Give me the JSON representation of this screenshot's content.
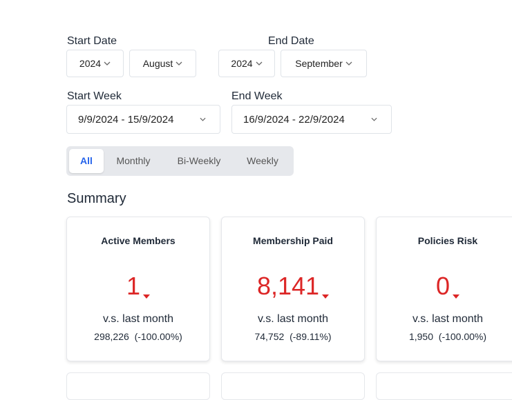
{
  "filters": {
    "start_date_label": "Start Date",
    "end_date_label": "End Date",
    "start_year": "2024",
    "start_month": "August",
    "end_year": "2024",
    "end_month": "September",
    "start_week_label": "Start Week",
    "end_week_label": "End Week",
    "start_week": "9/9/2024 - 15/9/2024",
    "end_week": "16/9/2024 - 22/9/2024"
  },
  "tabs": [
    {
      "label": "All",
      "active": true
    },
    {
      "label": "Monthly",
      "active": false
    },
    {
      "label": "Bi-Weekly",
      "active": false
    },
    {
      "label": "Weekly",
      "active": false
    }
  ],
  "summary": {
    "title": "Summary",
    "cards": [
      {
        "title": "Active Members",
        "value": "1",
        "comparison": "v.s. last month",
        "previous": "298,226",
        "change": "(-100.00%)"
      },
      {
        "title": "Membership Paid",
        "value": "8,141",
        "comparison": "v.s. last month",
        "previous": "74,752",
        "change": "(-89.11%)"
      },
      {
        "title": "Policies Risk",
        "value": "0",
        "comparison": "v.s. last month",
        "previous": "1,950",
        "change": "(-100.00%)"
      }
    ]
  },
  "colors": {
    "negative": "#dc2626",
    "accent": "#2563eb",
    "tab_bg": "#e6e8ec"
  },
  "icons": {
    "dropdown": "chevron-down-icon",
    "trend": "caret-down-icon"
  }
}
